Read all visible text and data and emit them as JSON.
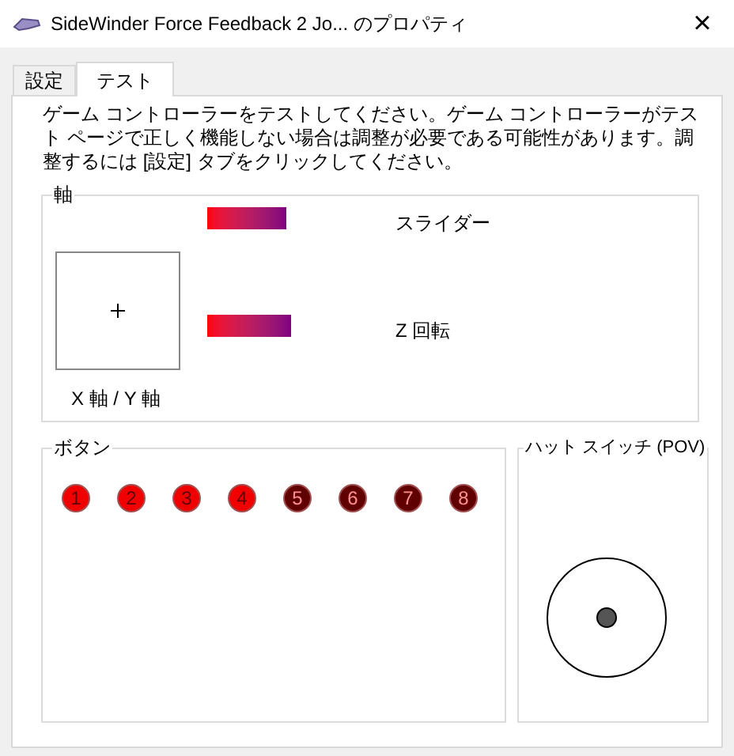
{
  "window": {
    "title": "SideWinder Force Feedback 2 Jo... のプロパティ",
    "close": "×"
  },
  "tabs": [
    {
      "label": "設定",
      "selected": false
    },
    {
      "label": "テスト",
      "selected": true
    }
  ],
  "description": "ゲーム コントローラーをテストしてください。ゲーム コントローラーがテスト ページで正しく機能しない場合は調整が必要である可能性があります。調整するには [設定] タブをクリックしてください。",
  "axes": {
    "title": "軸",
    "xy_label": "X 軸 / Y 軸",
    "sliders": [
      {
        "label": "スライダー"
      },
      {
        "label": "Z 回転"
      }
    ]
  },
  "buttons": {
    "title": "ボタン",
    "items": [
      {
        "label": "1",
        "pressed": true
      },
      {
        "label": "2",
        "pressed": true
      },
      {
        "label": "3",
        "pressed": true
      },
      {
        "label": "4",
        "pressed": true
      },
      {
        "label": "5",
        "pressed": false
      },
      {
        "label": "6",
        "pressed": false
      },
      {
        "label": "7",
        "pressed": false
      },
      {
        "label": "8",
        "pressed": false
      }
    ]
  },
  "pov": {
    "title": "ハット スイッチ (POV)"
  }
}
